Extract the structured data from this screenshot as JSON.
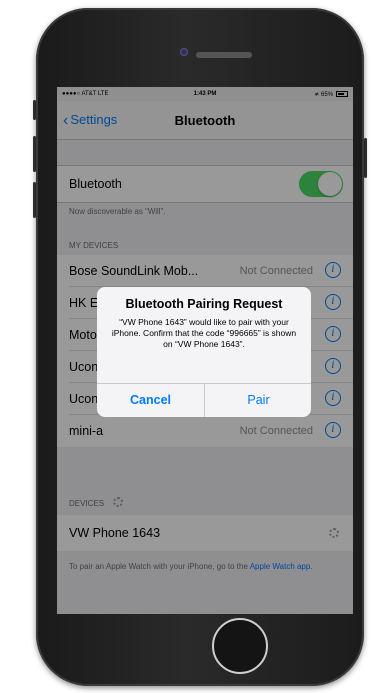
{
  "status_bar": {
    "carrier": "●●●●○ AT&T  LTE",
    "time": "1:43 PM",
    "battery": "≭ 65%"
  },
  "navbar": {
    "back_label": "Settings",
    "title": "Bluetooth"
  },
  "bluetooth_toggle": {
    "label": "Bluetooth",
    "on": true,
    "color": "#4cd964"
  },
  "discoverable_note": "Now discoverable as “Will”.",
  "my_devices": {
    "header": "MY DEVICES",
    "items": [
      {
        "name": "Bose SoundLink Mob...",
        "status": "Not Connected"
      },
      {
        "name": "HK E",
        "status": ""
      },
      {
        "name": "Moto",
        "status": ""
      },
      {
        "name": "Ucon",
        "status": ""
      },
      {
        "name": "Ucon",
        "status": ""
      },
      {
        "name": "mini-a",
        "status": "Not Connected"
      }
    ]
  },
  "devices": {
    "header": "DEVICES",
    "items": [
      {
        "name": "VW Phone 1643"
      }
    ]
  },
  "watch_note": {
    "text": "To pair an Apple Watch with your iPhone, go to the ",
    "link": "Apple Watch app."
  },
  "alert": {
    "title": "Bluetooth Pairing Request",
    "message": "“VW Phone 1643” would like to pair with your iPhone. Confirm that the code “996665” is shown on “VW Phone 1643”.",
    "cancel_label": "Cancel",
    "pair_label": "Pair"
  },
  "colors": {
    "accent": "#007aff",
    "toggle_on": "#4cd964"
  }
}
